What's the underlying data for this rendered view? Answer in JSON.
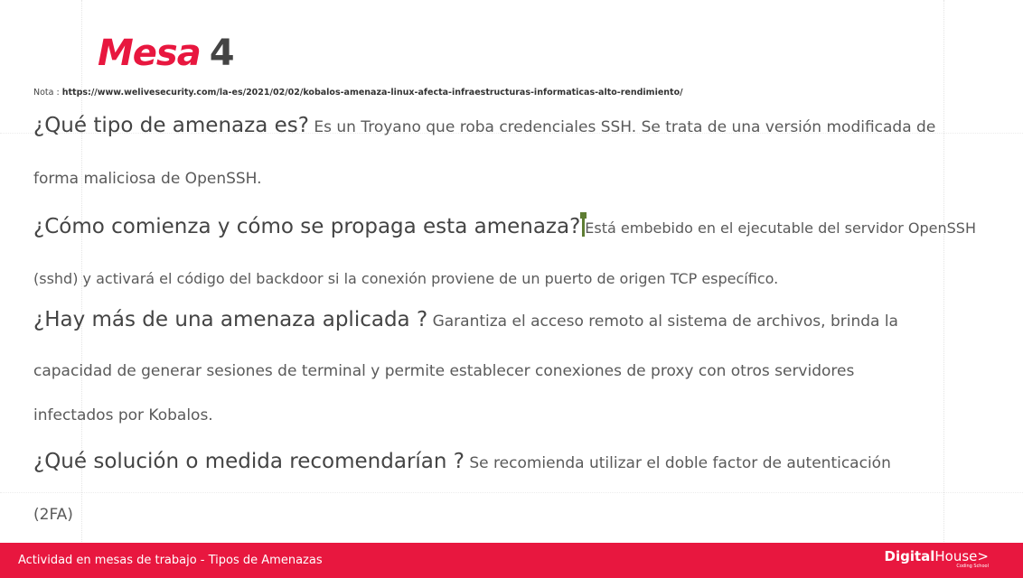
{
  "slide": {
    "title_red": "Mesa",
    "title_number": "4",
    "note_label": "Nota : ",
    "note_url": "https://www.welivesecurity.com/la-es/2021/02/02/kobalos-amenaza-linux-afecta-infraestructuras-informaticas-alto-rendimiento/",
    "q1_question": "¿Qué tipo de amenaza es?",
    "q1_answer_1": " Es un Troyano que roba credenciales SSH. Se trata de una versión modificada de",
    "q1_answer_2": "forma maliciosa de OpenSSH.",
    "q2_question": "¿Cómo comienza y cómo se propaga esta amenaza?",
    "q2_answer_1": "Está embebido en el ejecutable del servidor OpenSSH",
    "q2_answer_2": "(sshd) y activará el código del backdoor si la conexión proviene de un puerto de origen TCP específico.",
    "q3_question": "¿Hay más de una amenaza aplicada ?",
    "q3_answer_1": " Garantiza el acceso remoto al sistema de archivos, brinda la",
    "q3_answer_2": "capacidad de generar sesiones de terminal y permite establecer conexiones de proxy con otros servidores",
    "q3_answer_3": "infectados por Kobalos.",
    "q4_question": "¿Qué solución o medida recomendarían ?",
    "q4_answer_1": " Se recomienda utilizar el doble factor de autenticación",
    "q4_answer_2": "(2FA)"
  },
  "footer": {
    "text": "Actividad en mesas de trabajo - Tipos de Amenazas",
    "logo_bold": "Digital",
    "logo_thin": "House",
    "logo_arrow": ">",
    "logo_sub": "Coding School"
  },
  "colors": {
    "accent": "#e8173f",
    "text": "#555555",
    "cursor": "#5e7d33"
  }
}
